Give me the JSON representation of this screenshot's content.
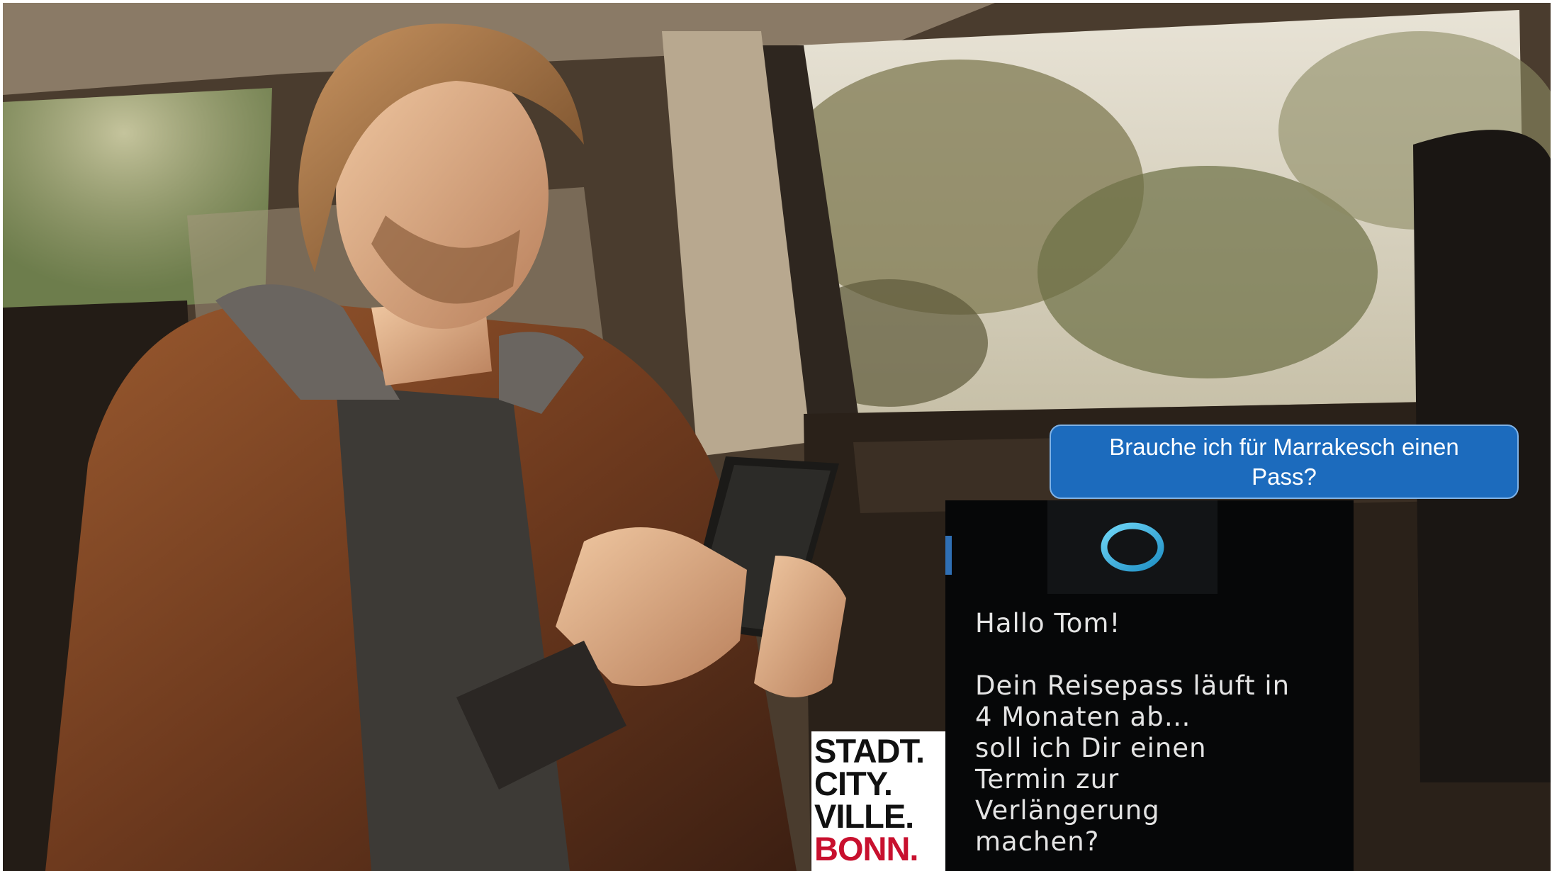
{
  "query": {
    "text": "Brauche ich für Marrakesch einen Pass?"
  },
  "assistant": {
    "icon": "cortana-ring-icon",
    "greeting": "Hallo Tom!",
    "message": [
      "Dein Reisepass läuft in",
      "4 Monaten ab…",
      "soll ich Dir einen",
      "Termin zur",
      "Verlängerung",
      "machen?"
    ]
  },
  "logo": {
    "lines": [
      "STADT.",
      "CITY.",
      "VILLE.",
      "BONN."
    ],
    "colors": {
      "text": "#111111",
      "accent": "#c8102e"
    }
  },
  "colors": {
    "bubble": "#1c6bbd",
    "panel": "#060708",
    "ring": "#2aa7d8"
  }
}
